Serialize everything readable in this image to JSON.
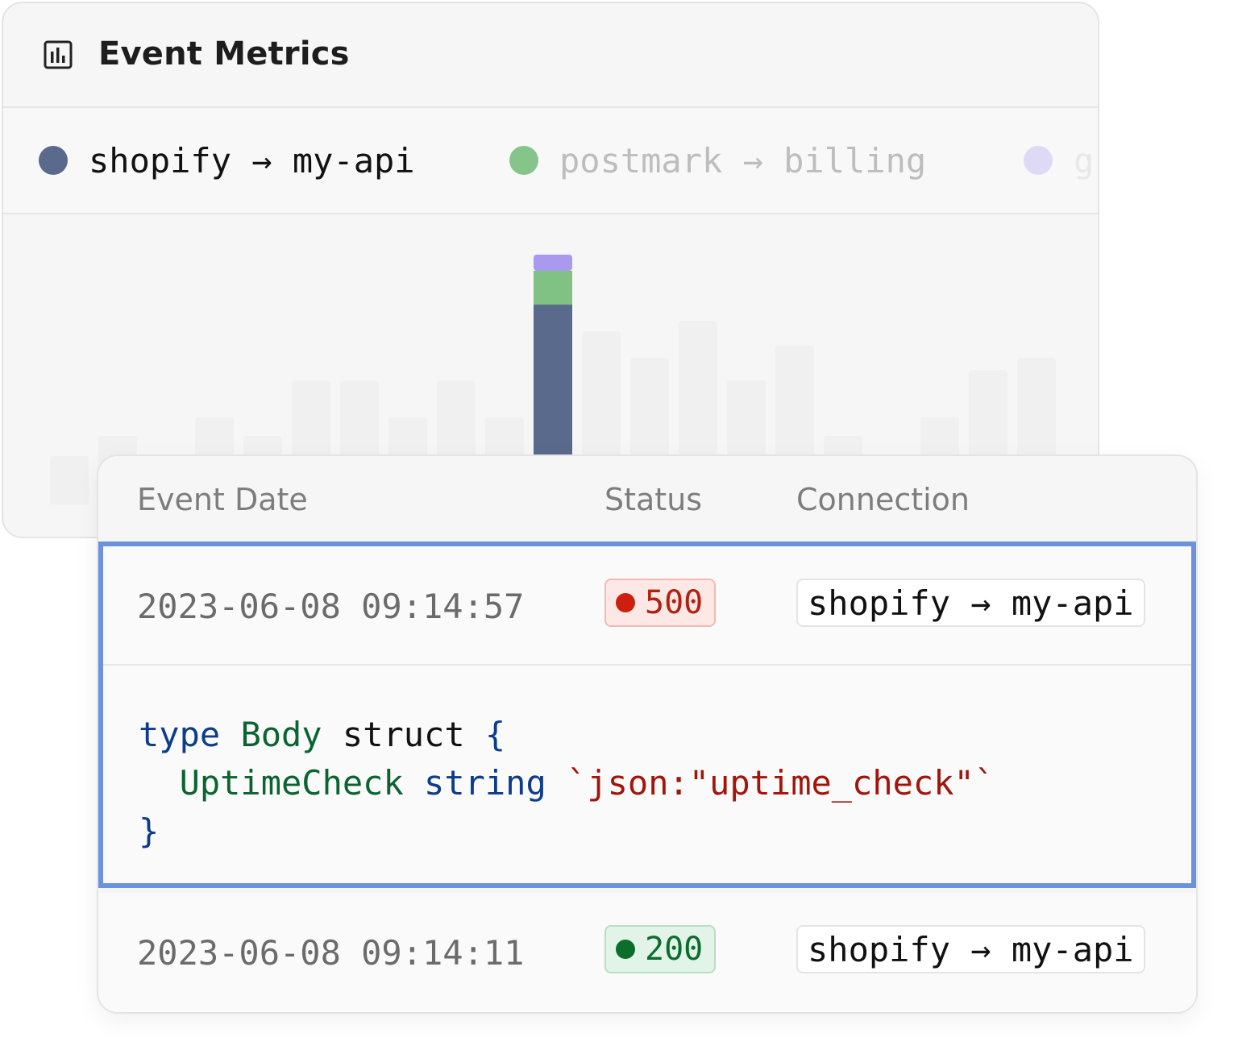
{
  "metrics": {
    "title": "Event Metrics",
    "icon": "bar-chart-icon",
    "legend": [
      {
        "label": "shopify → my-api",
        "color": "#5a6a8d"
      },
      {
        "label": "postmark → billing",
        "color": "#7fc284"
      },
      {
        "label": "g",
        "color": "#b0a3f0"
      }
    ]
  },
  "chart_data": {
    "type": "bar",
    "stacked": true,
    "highlighted_index": 10,
    "series_colors": [
      "#5a6a8d",
      "#7fc284",
      "#a99af0"
    ],
    "totals": [
      60,
      85,
      60,
      108,
      85,
      154,
      154,
      108,
      154,
      108,
      250,
      215,
      182,
      228,
      154,
      197,
      85,
      54,
      108,
      167,
      182
    ],
    "highlight_values": [
      188,
      42,
      20
    ]
  },
  "events": {
    "columns": {
      "date": "Event Date",
      "status": "Status",
      "connection": "Connection"
    },
    "rows": [
      {
        "date": "2023-06-08 09:14:57",
        "status": "500",
        "status_kind": "error",
        "connection": "shopify → my-api"
      },
      {
        "date": "2023-06-08 09:14:11",
        "status": "200",
        "status_kind": "ok",
        "connection": "shopify → my-api"
      }
    ],
    "code": {
      "line1": {
        "kw": "type",
        "name": "Body",
        "kw2": "struct",
        "brace": "{"
      },
      "line2": {
        "field": "UptimeCheck",
        "type": "string",
        "tag": "`json:\"uptime_check\"`"
      },
      "line3": {
        "brace": "}"
      }
    }
  }
}
